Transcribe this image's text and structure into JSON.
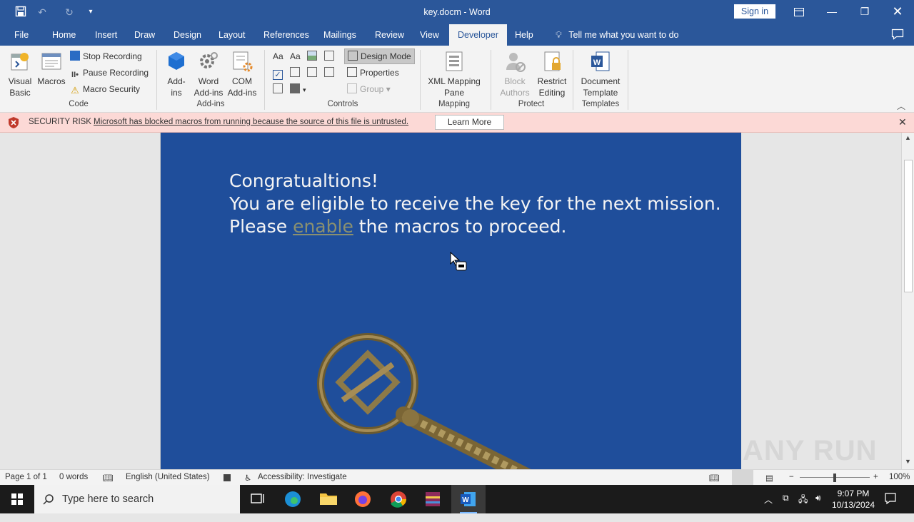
{
  "window": {
    "title": "key.docm  -  Word",
    "sign_in": "Sign in"
  },
  "tabs": [
    "File",
    "Home",
    "Insert",
    "Draw",
    "Design",
    "Layout",
    "References",
    "Mailings",
    "Review",
    "View",
    "Developer",
    "Help"
  ],
  "active_tab": "Developer",
  "tell_me": "Tell me what you want to do",
  "ribbon": {
    "code": {
      "visual_basic": "Visual\nBasic",
      "macros": "Macros",
      "stop_recording": "Stop Recording",
      "pause_recording": "Pause Recording",
      "macro_security": "Macro Security",
      "label": "Code"
    },
    "addins": {
      "addins": "Add-\nins",
      "word_addins": "Word\nAdd-ins",
      "com_addins": "COM\nAdd-ins",
      "label": "Add-ins"
    },
    "controls": {
      "design_mode": "Design Mode",
      "properties": "Properties",
      "group": "Group",
      "label": "Controls"
    },
    "mapping": {
      "xml_mapping": "XML Mapping\nPane",
      "label": "Mapping"
    },
    "protect": {
      "block_authors": "Block\nAuthors",
      "restrict_editing": "Restrict\nEditing",
      "label": "Protect"
    },
    "templates": {
      "document_template": "Document\nTemplate",
      "label": "Templates"
    }
  },
  "security_bar": {
    "title": "SECURITY RISK",
    "message": "Microsoft has blocked macros from running because the source of this file is untrusted.",
    "button": "Learn More"
  },
  "document": {
    "line1": "Congratualtions!",
    "line2": "You are eligible to receive the key for the next mission.",
    "line3_pre": "Please ",
    "line3_link": "enable",
    "line3_post": " the macros to proceed."
  },
  "status": {
    "page": "Page 1 of 1",
    "words": "0 words",
    "language": "English (United States)",
    "accessibility": "Accessibility: Investigate",
    "zoom": "100%"
  },
  "taskbar": {
    "search_placeholder": "Type here to search",
    "time": "9:07 PM",
    "date": "10/13/2024"
  },
  "watermark": "ANY RUN",
  "colors": {
    "word_blue": "#2b579a",
    "page_blue": "#1f4e9b",
    "security_pink": "#fcd9d6"
  }
}
